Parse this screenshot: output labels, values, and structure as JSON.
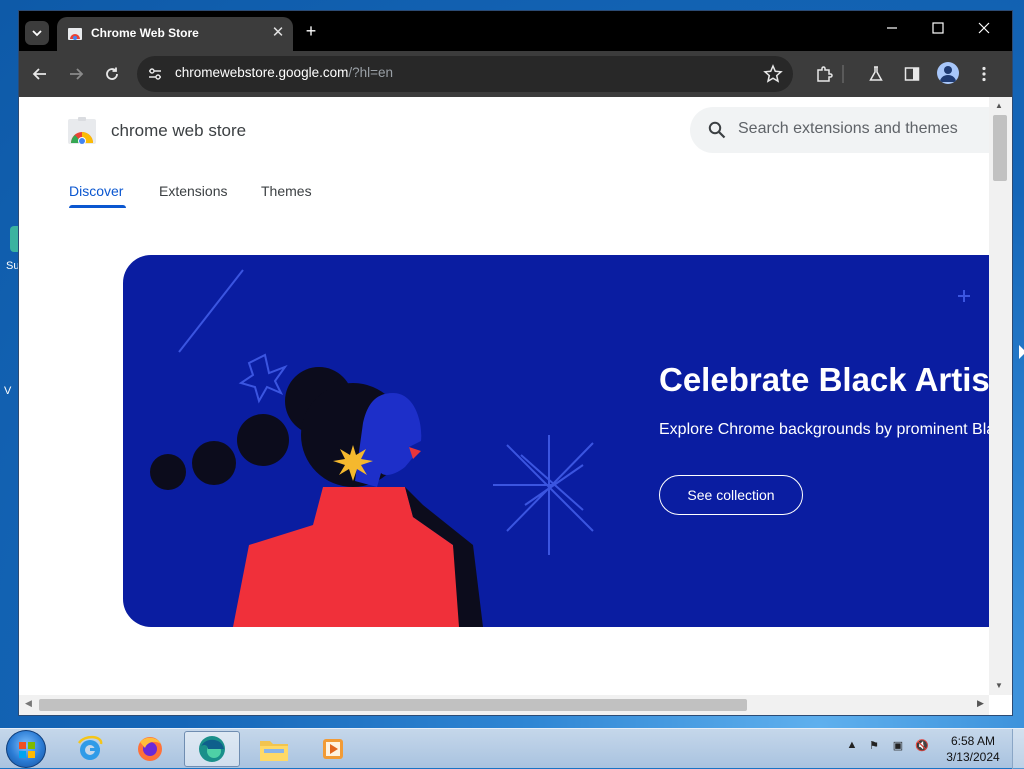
{
  "desktop": {
    "icon_label": "Su",
    "edge_text": "V"
  },
  "browser": {
    "tab": {
      "title": "Chrome Web Store",
      "close_glyph": "✕"
    },
    "newtab_glyph": "+",
    "url_host": "chromewebstore.google.com",
    "url_rest": "/?hl=en"
  },
  "site": {
    "name": "chrome web store",
    "search_placeholder": "Search extensions and themes",
    "nav": [
      {
        "label": "Discover",
        "active": true
      },
      {
        "label": "Extensions",
        "active": false
      },
      {
        "label": "Themes",
        "active": false
      }
    ],
    "hero": {
      "title": "Celebrate Black Artists",
      "subtitle": "Explore Chrome backgrounds by prominent Black artists",
      "button": "See collection",
      "bg_color": "#0a1da1"
    }
  },
  "taskbar": {
    "apps": [
      "internet-explorer",
      "firefox",
      "edge",
      "file-explorer",
      "media-player"
    ],
    "time": "6:58 AM",
    "date": "3/13/2024"
  },
  "colors": {
    "accent": "#0b57d0",
    "chrome_dark": "#3c3c3c"
  }
}
